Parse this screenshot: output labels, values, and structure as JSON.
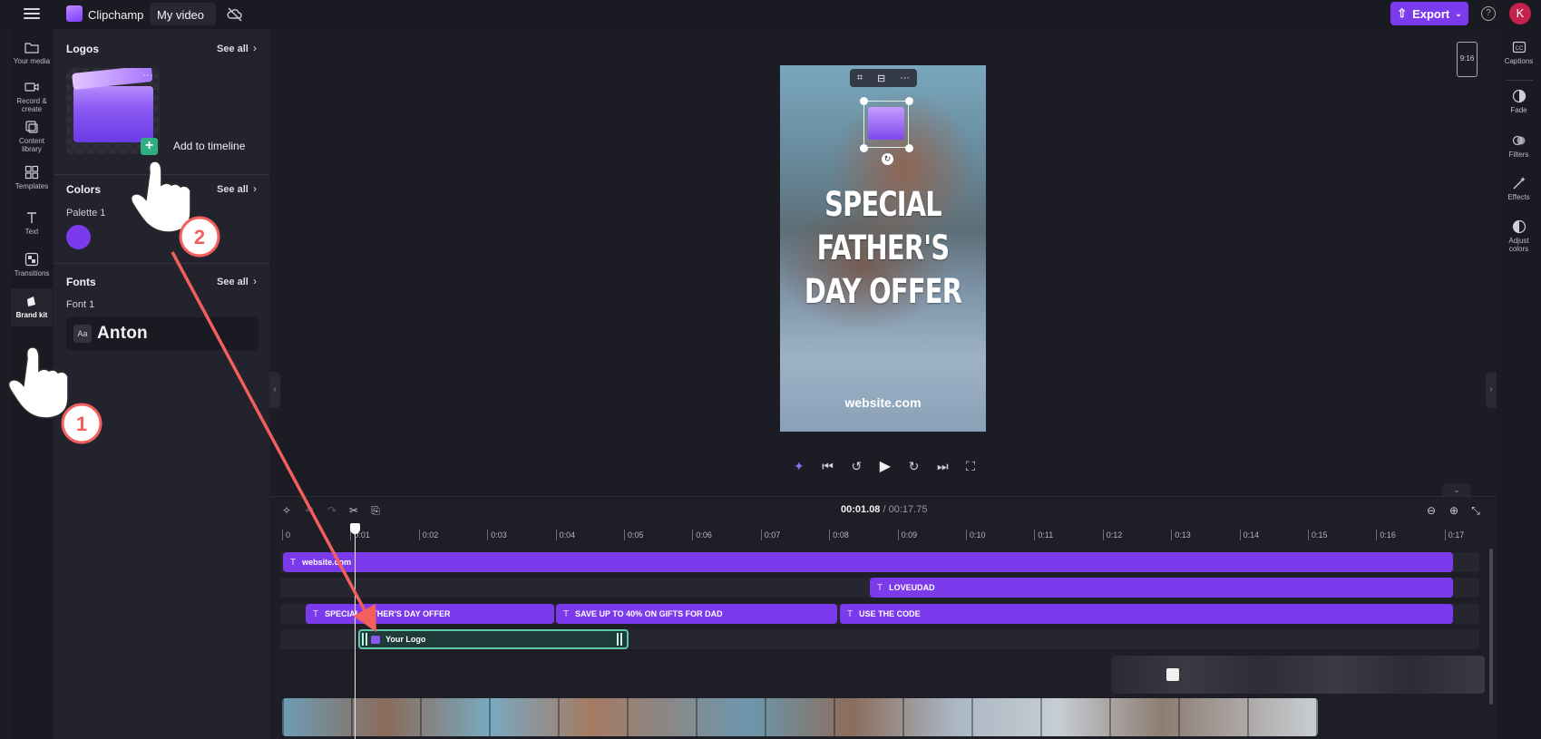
{
  "topbar": {
    "app_name": "Clipchamp",
    "video_title": "My video",
    "export_label": "Export",
    "avatar_initial": "K"
  },
  "left_rail": {
    "items": [
      {
        "label": "Your media",
        "icon": "folder-icon"
      },
      {
        "label": "Record & create",
        "icon": "camera-icon"
      },
      {
        "label": "Content library",
        "icon": "library-icon"
      },
      {
        "label": "Templates",
        "icon": "templates-icon"
      },
      {
        "label": "Text",
        "icon": "text-icon"
      },
      {
        "label": "Transitions",
        "icon": "transitions-icon"
      },
      {
        "label": "Brand kit",
        "icon": "brand-kit-icon",
        "active": true
      }
    ]
  },
  "panel": {
    "logos": {
      "title": "Logos",
      "see_all": "See all",
      "add_to_timeline": "Add to timeline"
    },
    "colors": {
      "title": "Colors",
      "see_all": "See all",
      "palette_label": "Palette 1",
      "swatch_color": "#7c3aed"
    },
    "fonts": {
      "title": "Fonts",
      "see_all": "See all",
      "font_label": "Font 1",
      "font_preview": "Aa",
      "font_name": "Anton"
    }
  },
  "preview": {
    "aspect_ratio": "9:16",
    "headline": "SPECIAL FATHER'S DAY OFFER",
    "website": "website.com"
  },
  "right_rail": {
    "items": [
      {
        "label": "Captions",
        "icon": "captions-icon"
      },
      {
        "label": "Fade",
        "icon": "fade-icon"
      },
      {
        "label": "Filters",
        "icon": "filters-icon"
      },
      {
        "label": "Effects",
        "icon": "effects-icon"
      },
      {
        "label": "Adjust colors",
        "icon": "adjust-colors-icon"
      }
    ]
  },
  "timeline": {
    "current_time": "00:01.08",
    "total_time": "/ 00:17.75",
    "ticks": [
      "0",
      "0:01",
      "0:02",
      "0:03",
      "0:04",
      "0:05",
      "0:06",
      "0:07",
      "0:08",
      "0:09",
      "0:10",
      "0:11",
      "0:12",
      "0:13",
      "0:14",
      "0:15",
      "0:16",
      "0:17"
    ],
    "clips": {
      "website": "website.com",
      "loveudad": "LOVEUDAD",
      "special": "SPECIAL FATHER'S DAY OFFER",
      "save_up": "SAVE UP TO 40% ON GIFTS FOR DAD",
      "use_code": "USE THE CODE",
      "your_logo": "Your Logo"
    }
  },
  "annotations": {
    "step1": "1",
    "step2": "2",
    "arrow_color": "#f25f5c"
  }
}
